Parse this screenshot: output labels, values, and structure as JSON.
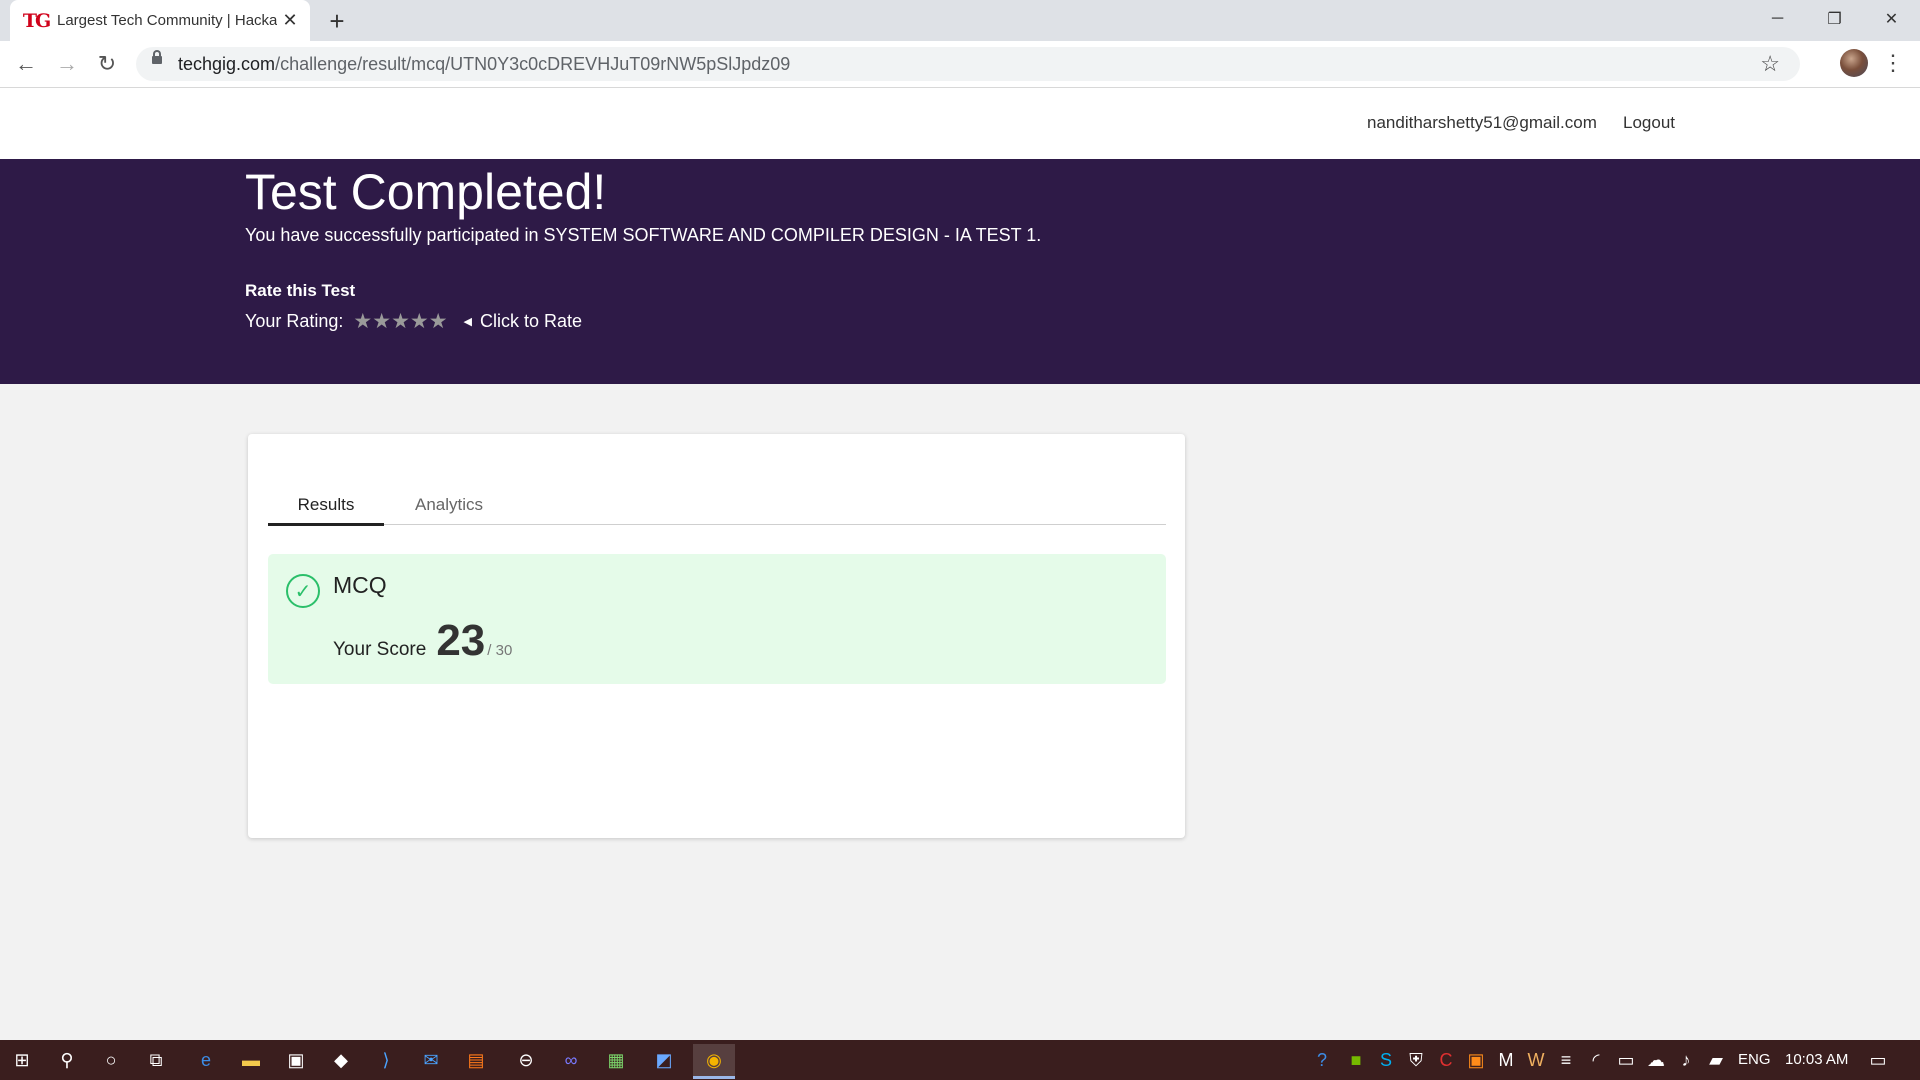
{
  "browser": {
    "tab_title": "Largest Tech Community | Hackathons",
    "favicon_text": "TG",
    "url_domain": "techgig.com",
    "url_path": "/challenge/result/mcq/UTN0Y3c0cDREVHJuT09rNW5pSlJpdz09"
  },
  "header": {
    "user_email": "nanditharshetty51@gmail.com",
    "logout_label": "Logout"
  },
  "banner": {
    "title": "Test Completed!",
    "subtitle": "You have successfully participated in SYSTEM SOFTWARE AND COMPILER DESIGN - IA TEST 1.",
    "rate_title": "Rate this Test",
    "rating_label": "Your Rating:",
    "rating_value": 0,
    "rating_max": 5,
    "click_to_rate": "Click to Rate"
  },
  "card": {
    "tabs": [
      {
        "label": "Results",
        "active": true
      },
      {
        "label": "Analytics",
        "active": false
      }
    ],
    "result": {
      "section": "MCQ",
      "score_label": "Your Score",
      "score": "23",
      "total": "/ 30"
    }
  },
  "taskbar": {
    "language": "ENG",
    "time": "10:03 AM"
  },
  "colors": {
    "banner_bg": "#2e1a47",
    "result_bg": "#e5fbe9",
    "check": "#2bbf6a"
  }
}
